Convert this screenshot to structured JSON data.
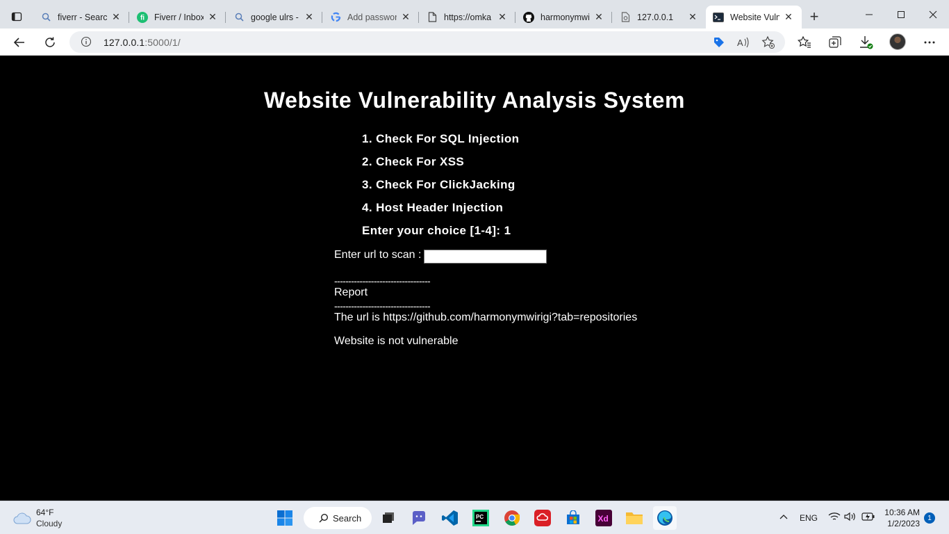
{
  "browser": {
    "tabs": [
      {
        "title": "fiverr - Search",
        "icon": "search-icon"
      },
      {
        "title": "Fiverr / Inbox",
        "icon": "fiverr-icon"
      },
      {
        "title": "google ulrs -",
        "icon": "search-icon"
      },
      {
        "title": "Add passwor",
        "icon": "google-icon"
      },
      {
        "title": "https://omka",
        "icon": "document-icon"
      },
      {
        "title": "harmonymwir",
        "icon": "github-icon"
      },
      {
        "title": "127.0.0.1",
        "icon": "page-icon"
      },
      {
        "title": "Website Vulne",
        "icon": "terminal-icon"
      }
    ],
    "address": {
      "host": "127.0.0.1",
      "path": ":5000/1/"
    }
  },
  "page": {
    "title": "Website Vulnerability Analysis System",
    "menu": [
      "1. Check For SQL Injection",
      "2. Check For XSS",
      "3. Check For ClickJacking",
      "4. Host Header Injection"
    ],
    "choice_prompt": "Enter your choice [1-4]: 1",
    "scan_label": "Enter url to scan :",
    "scan_value": "",
    "separator": "----------------------------------",
    "report_heading": "Report",
    "result_url": "The url is https://github.com/harmonymwirigi?tab=repositories",
    "result_status": "Website is not vulnerable"
  },
  "taskbar": {
    "weather_temp": "64°F",
    "weather_desc": "Cloudy",
    "search_label": "Search",
    "language": "ENG",
    "time": "10:36 AM",
    "date": "1/2/2023",
    "notifications": "1",
    "apps": [
      "start-icon",
      "file-explorer-icon",
      "teams-chat-icon",
      "vscode-icon",
      "pycharm-icon",
      "chrome-icon",
      "creative-cloud-icon",
      "store-icon",
      "adobe-xd-icon",
      "folder-icon",
      "edge-icon"
    ]
  }
}
